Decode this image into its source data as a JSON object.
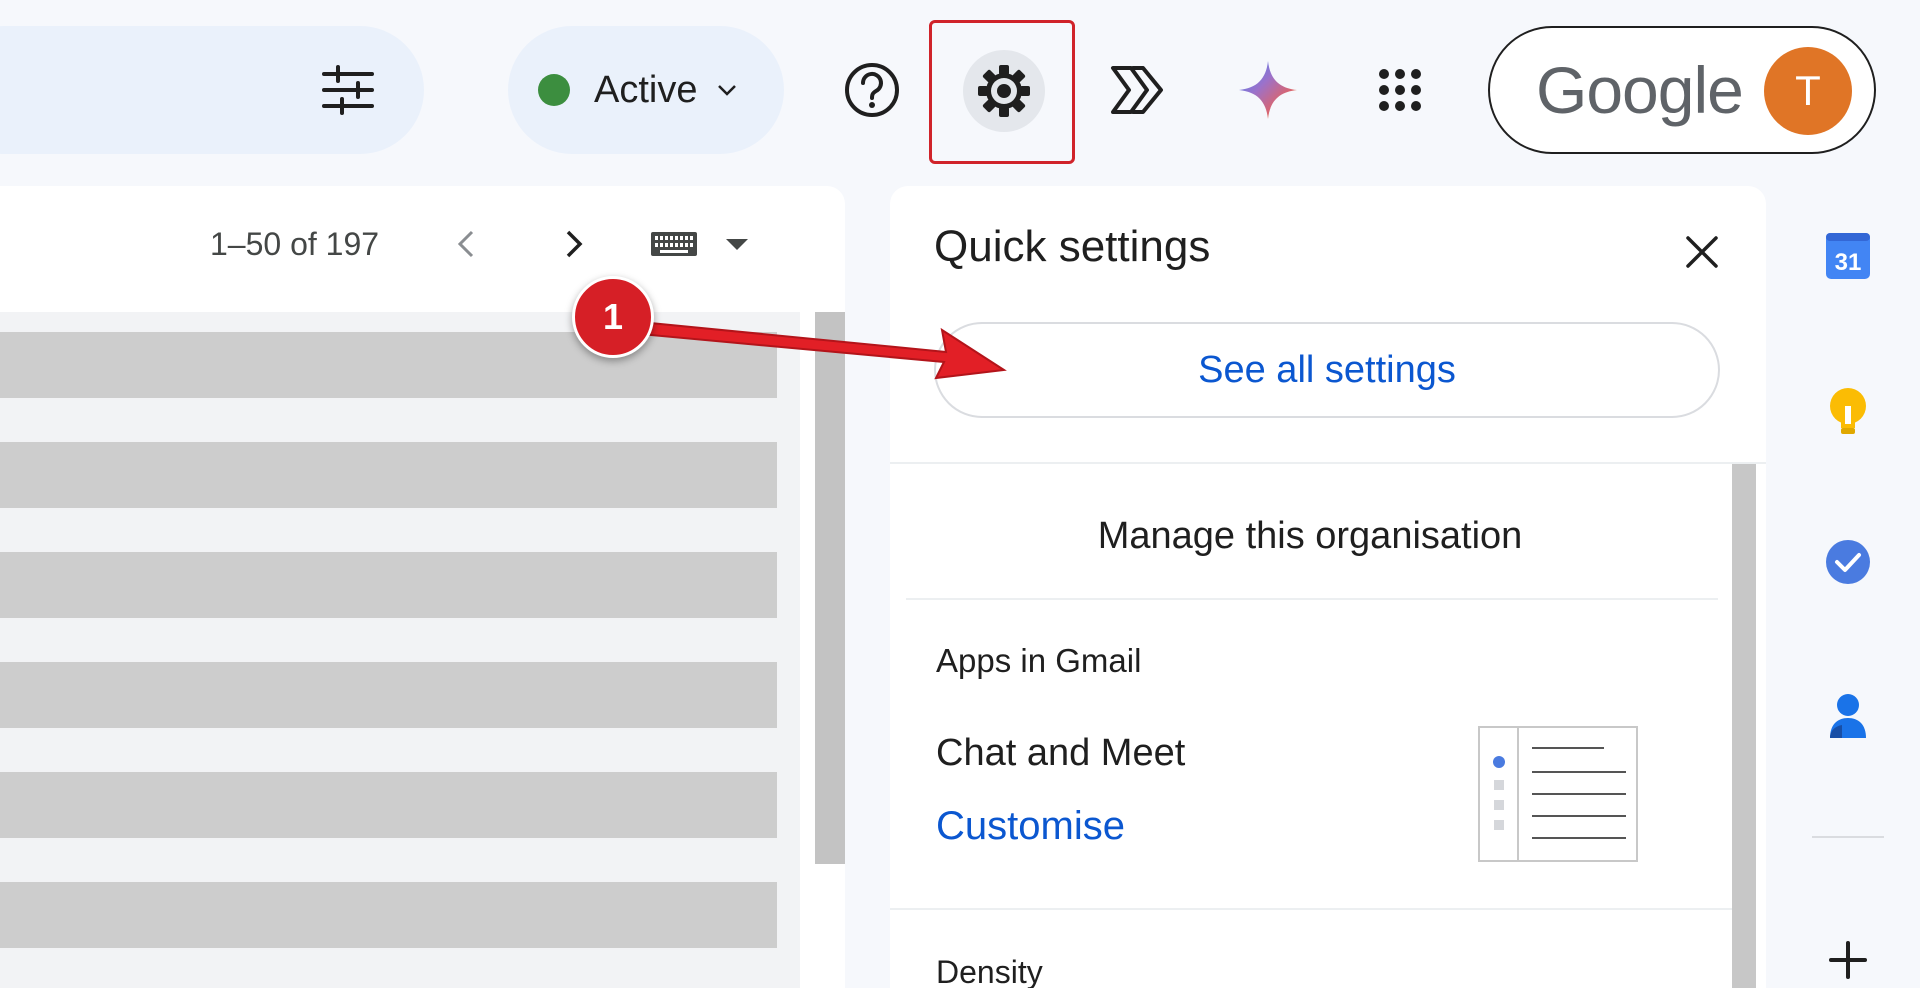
{
  "header": {
    "status_label": "Active",
    "status_color": "#3c8e3f",
    "brand_word": "Google",
    "avatar_initial": "T",
    "avatar_color": "#e07526",
    "icons": [
      "filter-icon",
      "help-icon",
      "settings-gear-icon",
      "sparkle-shortcut-icon",
      "gemini-icon",
      "apps-grid-icon"
    ]
  },
  "mail_list": {
    "pagination": "1–50 of 197",
    "row_count_visible": 6
  },
  "quick_settings": {
    "title": "Quick settings",
    "see_all_label": "See all settings",
    "manage_org_label": "Manage this organisation",
    "apps_section_label": "Apps in Gmail",
    "chat_meet_label": "Chat and Meet",
    "customise_label": "Customise",
    "density_label": "Density"
  },
  "side_apps": {
    "calendar_day": "31",
    "items": [
      "calendar-icon",
      "keep-icon",
      "tasks-icon",
      "contacts-icon",
      "add-icon"
    ]
  },
  "annotation": {
    "step_number": "1",
    "highlight_color": "#d0232a"
  }
}
